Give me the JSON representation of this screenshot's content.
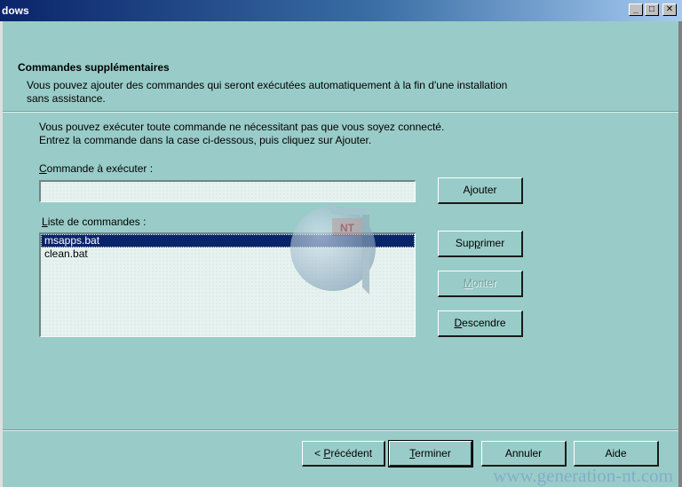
{
  "window": {
    "title": "dows",
    "controls": {
      "minimize": "_",
      "maximize": "□",
      "close": "✕"
    }
  },
  "header": {
    "title": "Commandes supplémentaires",
    "subtitle_line1": "Vous pouvez ajouter des commandes qui seront exécutées automatiquement à la fin d'une installation",
    "subtitle_line2": "sans assistance."
  },
  "body": {
    "info_line1": "Vous pouvez exécuter toute commande ne nécessitant pas que vous soyez connecté.",
    "info_line2": "Entrez la commande dans la case ci-dessous, puis cliquez sur Ajouter.",
    "command_label_key": "C",
    "command_label_rest": "ommande à exécuter :",
    "command_value": "",
    "list_label_key": "L",
    "list_label_rest": "iste de commandes :",
    "commands": [
      "msapps.bat",
      "clean.bat"
    ],
    "selected_index": 0
  },
  "buttons": {
    "add_pre": "A",
    "add_key": "j",
    "add_post": "outer",
    "delete_pre": "Sup",
    "delete_key": "p",
    "delete_post": "rimer",
    "up_pre": "",
    "up_key": "M",
    "up_post": "onter",
    "down_pre": "",
    "down_key": "D",
    "down_post": "escendre",
    "back_pre": "< ",
    "back_key": "P",
    "back_post": "récédent",
    "finish_pre": "",
    "finish_key": "T",
    "finish_post": "erminer",
    "cancel": "Annuler",
    "help": "Aide"
  },
  "watermark": {
    "logo_text": "NT",
    "site": "www.generation-nt.com"
  },
  "colors": {
    "dialog_bg": "#99ccc8",
    "title_start": "#0a246a",
    "title_end": "#a6caf0",
    "selection": "#0a246a"
  }
}
